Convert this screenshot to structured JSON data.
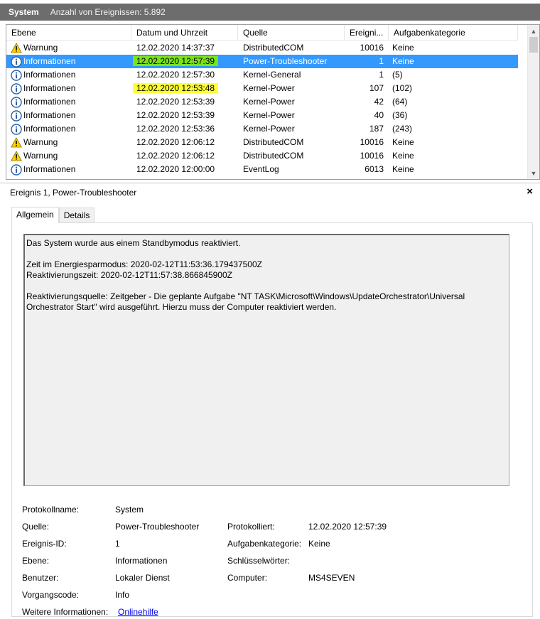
{
  "header": {
    "title": "System",
    "count": "Anzahl von Ereignissen: 5.892"
  },
  "columns": [
    "Ebene",
    "Datum und Uhrzeit",
    "Quelle",
    "Ereigni...",
    "Aufgabenkategorie"
  ],
  "rows": [
    {
      "level": "Warnung",
      "icon": "warning-icon",
      "date": "12.02.2020 14:37:37",
      "source": "DistributedCOM",
      "id": "10016",
      "cat": "Keine",
      "hl": ""
    },
    {
      "level": "Informationen",
      "icon": "info-icon",
      "date": "12.02.2020 12:57:39",
      "source": "Power-Troubleshooter",
      "id": "1",
      "cat": "Keine",
      "hl": "green",
      "selected": true
    },
    {
      "level": "Informationen",
      "icon": "info-icon",
      "date": "12.02.2020 12:57:30",
      "source": "Kernel-General",
      "id": "1",
      "cat": "(5)",
      "hl": ""
    },
    {
      "level": "Informationen",
      "icon": "info-icon",
      "date": "12.02.2020 12:53:48",
      "source": "Kernel-Power",
      "id": "107",
      "cat": "(102)",
      "hl": "yellow"
    },
    {
      "level": "Informationen",
      "icon": "info-icon",
      "date": "12.02.2020 12:53:39",
      "source": "Kernel-Power",
      "id": "42",
      "cat": "(64)",
      "hl": ""
    },
    {
      "level": "Informationen",
      "icon": "info-icon",
      "date": "12.02.2020 12:53:39",
      "source": "Kernel-Power",
      "id": "40",
      "cat": "(36)",
      "hl": ""
    },
    {
      "level": "Informationen",
      "icon": "info-icon",
      "date": "12.02.2020 12:53:36",
      "source": "Kernel-Power",
      "id": "187",
      "cat": "(243)",
      "hl": ""
    },
    {
      "level": "Warnung",
      "icon": "warning-icon",
      "date": "12.02.2020 12:06:12",
      "source": "DistributedCOM",
      "id": "10016",
      "cat": "Keine",
      "hl": ""
    },
    {
      "level": "Warnung",
      "icon": "warning-icon",
      "date": "12.02.2020 12:06:12",
      "source": "DistributedCOM",
      "id": "10016",
      "cat": "Keine",
      "hl": ""
    },
    {
      "level": "Informationen",
      "icon": "info-icon",
      "date": "12.02.2020 12:00:00",
      "source": "EventLog",
      "id": "6013",
      "cat": "Keine",
      "hl": ""
    }
  ],
  "details": {
    "title": "Ereignis 1, Power-Troubleshooter",
    "close": "×",
    "tabs": [
      "Allgemein",
      "Details"
    ],
    "message": {
      "line1": "Das System wurde aus einem Standbymodus reaktiviert.",
      "line2": "Zeit im Energiesparmodus: 2020-02-12T11:53:36.179437500Z",
      "line3": "Reaktivierungszeit: 2020-02-12T11:57:38.866845900Z",
      "line4": "Reaktivierungsquelle: Zeitgeber - Die geplante Aufgabe \"NT TASK\\Microsoft\\Windows\\UpdateOrchestrator\\Universal",
      "line5": "Orchestrator Start\" wird ausgeführt. Hierzu muss der Computer reaktiviert werden."
    },
    "props": {
      "protokollname_label": "Protokollname:",
      "protokollname": "System",
      "quelle_label": "Quelle:",
      "quelle": "Power-Troubleshooter",
      "protokolliert_label": "Protokolliert:",
      "protokolliert": "12.02.2020 12:57:39",
      "ereignisid_label": "Ereignis-ID:",
      "ereignisid": "1",
      "aufgabenkategorie_label": "Aufgabenkategorie:",
      "aufgabenkategorie": "Keine",
      "ebene_label": "Ebene:",
      "ebene": "Informationen",
      "schluessel_label": "Schlüsselwörter:",
      "benutzer_label": "Benutzer:",
      "benutzer": "Lokaler Dienst",
      "computer_label": "Computer:",
      "computer": "MS4SEVEN",
      "vorgangscode_label": "Vorgangscode:",
      "vorgangscode": "Info",
      "weitere_label": "Weitere Informationen:",
      "weitere_link": "Onlinehilfe"
    }
  },
  "colors": {
    "header_bg": "#6d6d6d",
    "selected_bg": "#3399ff",
    "highlight_green": "#7ae31a",
    "highlight_yellow": "#ffff36",
    "link": "#0000ee"
  }
}
